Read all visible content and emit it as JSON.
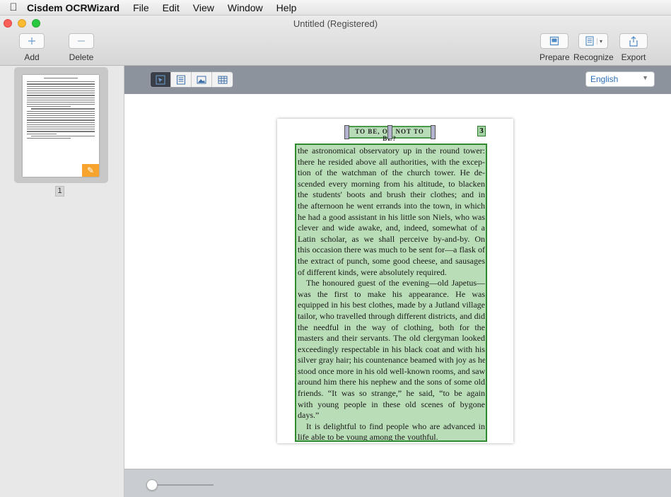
{
  "menubar": {
    "app_name": "Cisdem OCRWizard",
    "items": [
      "File",
      "Edit",
      "View",
      "Window",
      "Help"
    ]
  },
  "window": {
    "title": "Untitled (Registered)"
  },
  "toolbar": {
    "add_label": "Add",
    "delete_label": "Delete",
    "prepare_label": "Prepare",
    "recognize_label": "Recognize",
    "export_label": "Export"
  },
  "sidebar": {
    "page_number": "1"
  },
  "language": {
    "selected": "English"
  },
  "document": {
    "header": "TO BE, OR NOT TO BE?",
    "page_number": "3",
    "lines": [
      "the astronomical observatory up in the round tower:",
      "there he resided above all authorities, with the excep-",
      "tion of the watchman of the church tower. He de-",
      "scended every morning from his altitude, to blacken",
      "the students' boots and brush their clothes; and in",
      "the afternoon he went errands into the town, in which",
      "he had a good assistant in his little son Niels, who was",
      "clever and wide awake, and, indeed, somewhat of a",
      "Latin scholar, as we shall perceive by-and-by. On",
      "this occasion there was much to be sent for—a flask of",
      "the extract of punch, some good cheese, and sausages",
      "of different kinds, were absolutely required.",
      "The honoured guest of the evening—old Japetus—",
      "was the first to make his appearance. He was",
      "equipped in his best clothes, made by a Jutland village",
      "tailor, who travelled through different districts, and did",
      "the needful in the way of clothing, both for the",
      "masters and their servants. The old clergyman looked",
      "exceedingly respectable in his black coat and with his",
      "silver gray hair; his countenance beamed with joy as he",
      "stood once more in his old well-known rooms, and saw",
      "around him there his nephew and the sons of some old",
      "friends. “It was so strange,” he said, “to be again",
      "with young people in these old scenes of bygone",
      "days.”",
      "It is delightful to find people who are advanced in",
      "life able to be young among the youthful."
    ]
  }
}
